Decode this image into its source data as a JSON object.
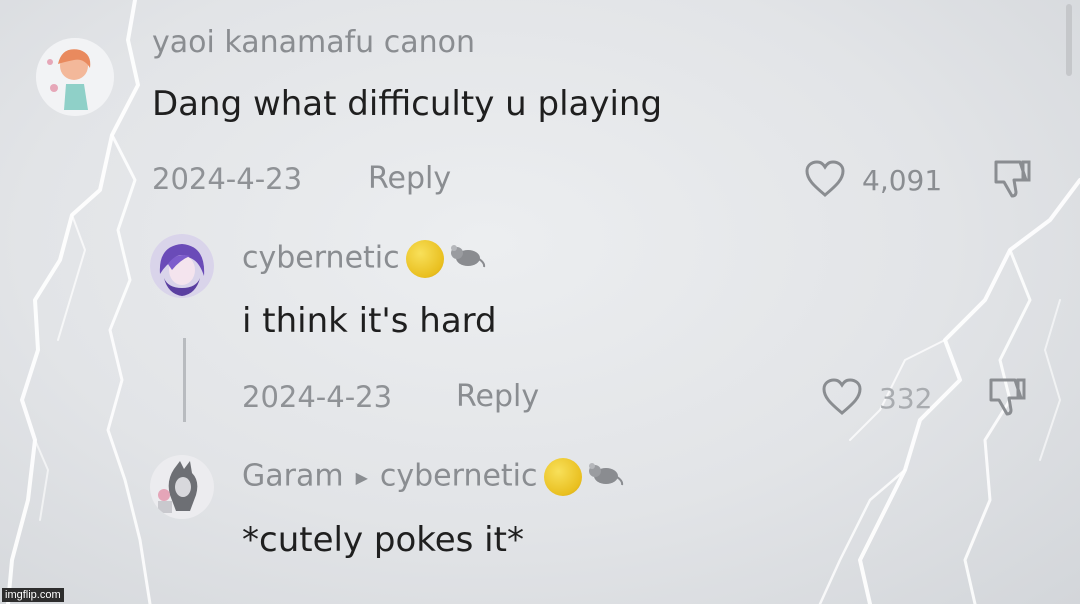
{
  "comments": [
    {
      "username": "yaoi kanamafu canon",
      "text": "Dang what difficulty u playing",
      "date": "2024-4-23",
      "reply_label": "Reply",
      "likes": "4,091"
    },
    {
      "username": "cybernetic",
      "text": "i think it's hard",
      "date": "2024-4-23",
      "reply_label": "Reply",
      "likes": "332"
    },
    {
      "username": "Garam",
      "reply_to": "cybernetic",
      "text": "*cutely pokes it*"
    }
  ],
  "watermark": "imgflip.com",
  "colors": {
    "background": "#dfe1e4",
    "text": "#1f1f1f",
    "muted": "#8a8d91",
    "badge_coin": "#e9bf1f"
  },
  "icons": [
    "heart-icon",
    "dislike-icon",
    "coin-badge-icon",
    "rat-badge-icon",
    "reply-arrow-icon"
  ]
}
